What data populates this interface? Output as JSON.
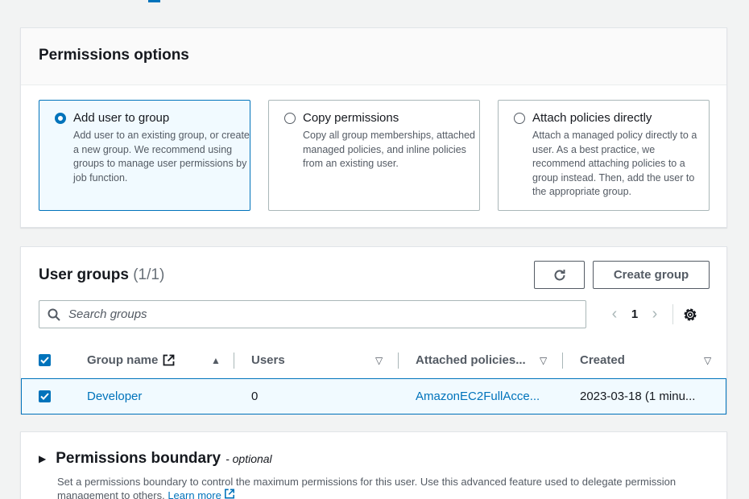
{
  "permissions_options": {
    "title": "Permissions options",
    "options": [
      {
        "title": "Add user to group",
        "desc": "Add user to an existing group, or create a new group. We recommend using groups to manage user permissions by job function.",
        "selected": true
      },
      {
        "title": "Copy permissions",
        "desc": "Copy all group memberships, attached managed policies, and inline policies from an existing user.",
        "selected": false
      },
      {
        "title": "Attach policies directly",
        "desc": "Attach a managed policy directly to a user. As a best practice, we recommend attaching policies to a group instead. Then, add the user to the appropriate group.",
        "selected": false
      }
    ]
  },
  "user_groups": {
    "title": "User groups",
    "count": "(1/1)",
    "create_label": "Create group",
    "search_placeholder": "Search groups",
    "page": "1",
    "columns": [
      "Group name",
      "Users",
      "Attached policies...",
      "Created"
    ],
    "rows": [
      {
        "group_name": "Developer",
        "users": "0",
        "policies": "AmazonEC2FullAcce...",
        "created": "2023-03-18 (1 minu..."
      }
    ]
  },
  "permissions_boundary": {
    "title": "Permissions boundary",
    "optional": "- optional",
    "description": "Set a permissions boundary to control the maximum permissions for this user. Use this advanced feature used to delegate permission management to others.",
    "learn_more": "Learn more"
  },
  "colors": {
    "accent": "#0073bb",
    "text": "#16191f",
    "secondary": "#545b64",
    "background": "#f2f3f3"
  }
}
